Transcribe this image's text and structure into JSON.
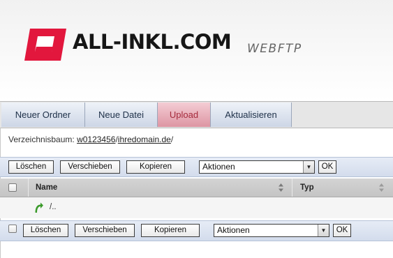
{
  "brand": {
    "name": "ALL-INKL.COM",
    "product": "WEBFTP",
    "accent": "#e2173d"
  },
  "nav": {
    "items": [
      {
        "label": "Neuer Ordner",
        "active": false
      },
      {
        "label": "Neue Datei",
        "active": false
      },
      {
        "label": "Upload",
        "active": true
      },
      {
        "label": "Aktualisieren",
        "active": false
      }
    ]
  },
  "breadcrumb": {
    "prefix": "Verzeichnisbaum: ",
    "parts": [
      "w0123456",
      "ihredomain.de"
    ],
    "separator": "/"
  },
  "actions": {
    "delete_label": "Löschen",
    "move_label": "Verschieben",
    "copy_label": "Kopieren",
    "select_value": "Aktionen",
    "ok_label": "OK"
  },
  "table": {
    "columns": [
      "Name",
      "Typ"
    ],
    "rows": [
      {
        "name": "/..",
        "icon": "up-arrow-icon"
      }
    ]
  }
}
